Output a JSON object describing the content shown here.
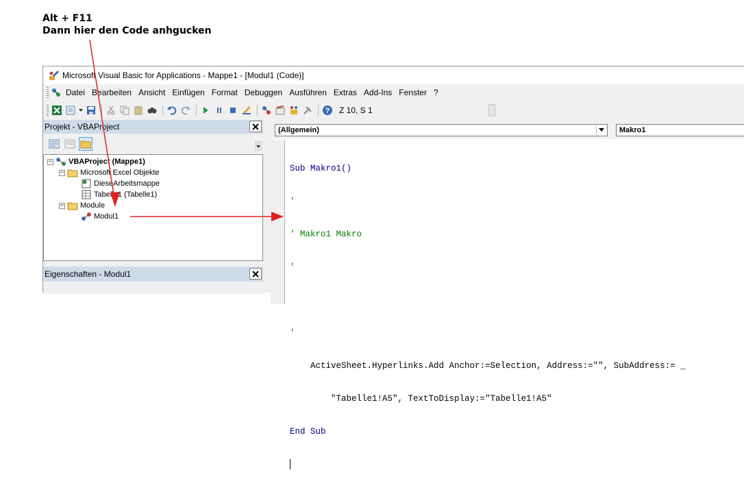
{
  "annotation": {
    "line1": "Alt + F11",
    "line2": "Dann hier den Code anhgucken"
  },
  "window": {
    "title": "Microsoft Visual Basic for Applications - Mappe1 - [Modul1 (Code)]"
  },
  "menu": [
    "Datei",
    "Bearbeiten",
    "Ansicht",
    "Einfügen",
    "Format",
    "Debuggen",
    "Ausführen",
    "Extras",
    "Add-Ins",
    "Fenster",
    "?"
  ],
  "toolbar": {
    "position": "Z 10, S 1"
  },
  "project_pane": {
    "title": "Projekt - VBAProject",
    "tree": {
      "root": "VBAProject (Mappe1)",
      "excel_objects_folder": "Microsoft Excel Objekte",
      "this_workbook": "DieseArbeitsmappe",
      "sheet1": "Tabelle1 (Tabelle1)",
      "modules_folder": "Module",
      "module1": "Modul1"
    }
  },
  "properties_pane": {
    "title": "Eigenschaften - Modul1"
  },
  "code_window": {
    "object_combo": "(Allgemein)",
    "procedure_combo": "Makro1",
    "lines": [
      {
        "type": "kw",
        "text": "Sub Makro1()"
      },
      {
        "type": "cm",
        "text": "'"
      },
      {
        "type": "cm",
        "text": "' Makro1 Makro"
      },
      {
        "type": "cm",
        "text": "'"
      },
      {
        "type": "plain",
        "text": ""
      },
      {
        "type": "cm",
        "text": "'"
      },
      {
        "type": "plain",
        "text": "    ActiveSheet.Hyperlinks.Add Anchor:=Selection, Address:=\"\", SubAddress:= _"
      },
      {
        "type": "plain",
        "text": "        \"Tabelle1!A5\", TextToDisplay:=\"Tabelle1!A5\""
      },
      {
        "type": "kw",
        "text": "End Sub"
      }
    ]
  },
  "colors": {
    "annotation_arrow": "#e02020",
    "pane_header": "#cfdbe9",
    "keyword": "#00008b",
    "comment": "#008000"
  }
}
